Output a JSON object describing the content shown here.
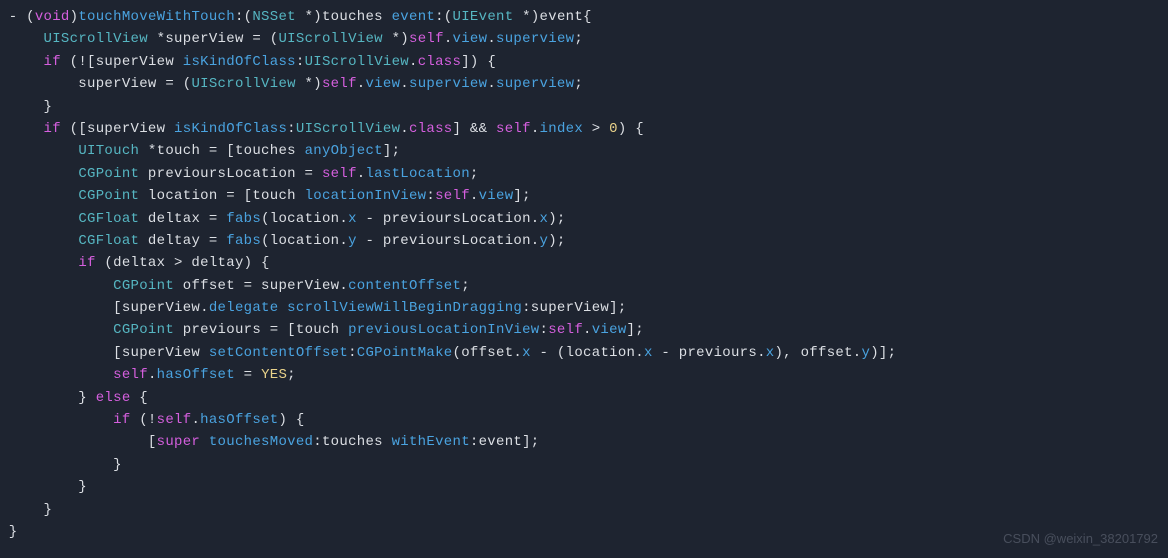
{
  "watermark": "CSDN @weixin_38201792",
  "code": {
    "lines": [
      [
        [
          "p",
          " - ("
        ],
        [
          "k",
          "void"
        ],
        [
          "p",
          ")"
        ],
        [
          "m",
          "touchMoveWithTouch"
        ],
        [
          "p",
          ":("
        ],
        [
          "t",
          "NSSet"
        ],
        [
          "p",
          " *)touches "
        ],
        [
          "m",
          "event"
        ],
        [
          "p",
          ":("
        ],
        [
          "t",
          "UIEvent"
        ],
        [
          "p",
          " *)event{"
        ]
      ],
      [
        [
          "p",
          "     "
        ],
        [
          "t",
          "UIScrollView"
        ],
        [
          "p",
          " *superView = ("
        ],
        [
          "t",
          "UIScrollView"
        ],
        [
          "p",
          " *)"
        ],
        [
          "s",
          "self"
        ],
        [
          "p",
          "."
        ],
        [
          "m",
          "view"
        ],
        [
          "p",
          "."
        ],
        [
          "m",
          "superview"
        ],
        [
          "p",
          ";"
        ]
      ],
      [
        [
          "p",
          "     "
        ],
        [
          "k",
          "if"
        ],
        [
          "p",
          " (!"
        ],
        [
          "p",
          "[superView "
        ],
        [
          "m",
          "isKindOfClass"
        ],
        [
          "p",
          ":"
        ],
        [
          "t",
          "UIScrollView"
        ],
        [
          "p",
          "."
        ],
        [
          "k",
          "class"
        ],
        [
          "p",
          "]) {"
        ]
      ],
      [
        [
          "p",
          "         superView = ("
        ],
        [
          "t",
          "UIScrollView"
        ],
        [
          "p",
          " *)"
        ],
        [
          "s",
          "self"
        ],
        [
          "p",
          "."
        ],
        [
          "m",
          "view"
        ],
        [
          "p",
          "."
        ],
        [
          "m",
          "superview"
        ],
        [
          "p",
          "."
        ],
        [
          "m",
          "superview"
        ],
        [
          "p",
          ";"
        ]
      ],
      [
        [
          "p",
          "     }"
        ]
      ],
      [
        [
          "p",
          "     "
        ],
        [
          "k",
          "if"
        ],
        [
          "p",
          " ([superView "
        ],
        [
          "m",
          "isKindOfClass"
        ],
        [
          "p",
          ":"
        ],
        [
          "t",
          "UIScrollView"
        ],
        [
          "p",
          "."
        ],
        [
          "k",
          "class"
        ],
        [
          "p",
          "] && "
        ],
        [
          "s",
          "self"
        ],
        [
          "p",
          "."
        ],
        [
          "m",
          "index"
        ],
        [
          "p",
          " > "
        ],
        [
          "n",
          "0"
        ],
        [
          "p",
          ") {"
        ]
      ],
      [
        [
          "p",
          "         "
        ],
        [
          "t",
          "UITouch"
        ],
        [
          "p",
          " *touch = [touches "
        ],
        [
          "m",
          "anyObject"
        ],
        [
          "p",
          "];"
        ]
      ],
      [
        [
          "p",
          "         "
        ],
        [
          "t",
          "CGPoint"
        ],
        [
          "p",
          " previoursLocation = "
        ],
        [
          "s",
          "self"
        ],
        [
          "p",
          "."
        ],
        [
          "m",
          "lastLocation"
        ],
        [
          "p",
          ";"
        ]
      ],
      [
        [
          "p",
          "         "
        ],
        [
          "t",
          "CGPoint"
        ],
        [
          "p",
          " location = [touch "
        ],
        [
          "m",
          "locationInView"
        ],
        [
          "p",
          ":"
        ],
        [
          "s",
          "self"
        ],
        [
          "p",
          "."
        ],
        [
          "m",
          "view"
        ],
        [
          "p",
          "];"
        ]
      ],
      [
        [
          "p",
          "         "
        ],
        [
          "t",
          "CGFloat"
        ],
        [
          "p",
          " deltax = "
        ],
        [
          "m",
          "fabs"
        ],
        [
          "p",
          "(location."
        ],
        [
          "m",
          "x"
        ],
        [
          "p",
          " - previoursLocation."
        ],
        [
          "m",
          "x"
        ],
        [
          "p",
          ");"
        ]
      ],
      [
        [
          "p",
          "         "
        ],
        [
          "t",
          "CGFloat"
        ],
        [
          "p",
          " deltay = "
        ],
        [
          "m",
          "fabs"
        ],
        [
          "p",
          "(location."
        ],
        [
          "m",
          "y"
        ],
        [
          "p",
          " - previoursLocation."
        ],
        [
          "m",
          "y"
        ],
        [
          "p",
          ");"
        ]
      ],
      [
        [
          "p",
          "         "
        ],
        [
          "k",
          "if"
        ],
        [
          "p",
          " (deltax > deltay) {"
        ]
      ],
      [
        [
          "p",
          "             "
        ],
        [
          "t",
          "CGPoint"
        ],
        [
          "p",
          " offset = superView."
        ],
        [
          "m",
          "contentOffset"
        ],
        [
          "p",
          ";"
        ]
      ],
      [
        [
          "p",
          "             [superView."
        ],
        [
          "m",
          "delegate"
        ],
        [
          "p",
          " "
        ],
        [
          "m",
          "scrollViewWillBeginDragging"
        ],
        [
          "p",
          ":superView];"
        ]
      ],
      [
        [
          "p",
          "             "
        ],
        [
          "t",
          "CGPoint"
        ],
        [
          "p",
          " previours = [touch "
        ],
        [
          "m",
          "previousLocationInView"
        ],
        [
          "p",
          ":"
        ],
        [
          "s",
          "self"
        ],
        [
          "p",
          "."
        ],
        [
          "m",
          "view"
        ],
        [
          "p",
          "];"
        ]
      ],
      [
        [
          "p",
          "             [superView "
        ],
        [
          "m",
          "setContentOffset"
        ],
        [
          "p",
          ":"
        ],
        [
          "m",
          "CGPointMake"
        ],
        [
          "p",
          "(offset."
        ],
        [
          "m",
          "x"
        ],
        [
          "p",
          " - (location."
        ],
        [
          "m",
          "x"
        ],
        [
          "p",
          " - previours."
        ],
        [
          "m",
          "x"
        ],
        [
          "p",
          "), offset."
        ],
        [
          "m",
          "y"
        ],
        [
          "p",
          ")];"
        ]
      ],
      [
        [
          "p",
          "             "
        ],
        [
          "s",
          "self"
        ],
        [
          "p",
          "."
        ],
        [
          "m",
          "hasOffset"
        ],
        [
          "p",
          " = "
        ],
        [
          "n",
          "YES"
        ],
        [
          "p",
          ";"
        ]
      ],
      [
        [
          "p",
          "         } "
        ],
        [
          "k",
          "else"
        ],
        [
          "p",
          " {"
        ]
      ],
      [
        [
          "p",
          "             "
        ],
        [
          "k",
          "if"
        ],
        [
          "p",
          " (!"
        ],
        [
          "s",
          "self"
        ],
        [
          "p",
          "."
        ],
        [
          "m",
          "hasOffset"
        ],
        [
          "p",
          ") {"
        ]
      ],
      [
        [
          "p",
          "                 ["
        ],
        [
          "s",
          "super"
        ],
        [
          "p",
          " "
        ],
        [
          "m",
          "touchesMoved"
        ],
        [
          "p",
          ":touches "
        ],
        [
          "m",
          "withEvent"
        ],
        [
          "p",
          ":event];"
        ]
      ],
      [
        [
          "p",
          "             }"
        ]
      ],
      [
        [
          "p",
          "         }"
        ]
      ],
      [
        [
          "p",
          "     }"
        ]
      ],
      [
        [
          "p",
          " }"
        ]
      ]
    ]
  }
}
